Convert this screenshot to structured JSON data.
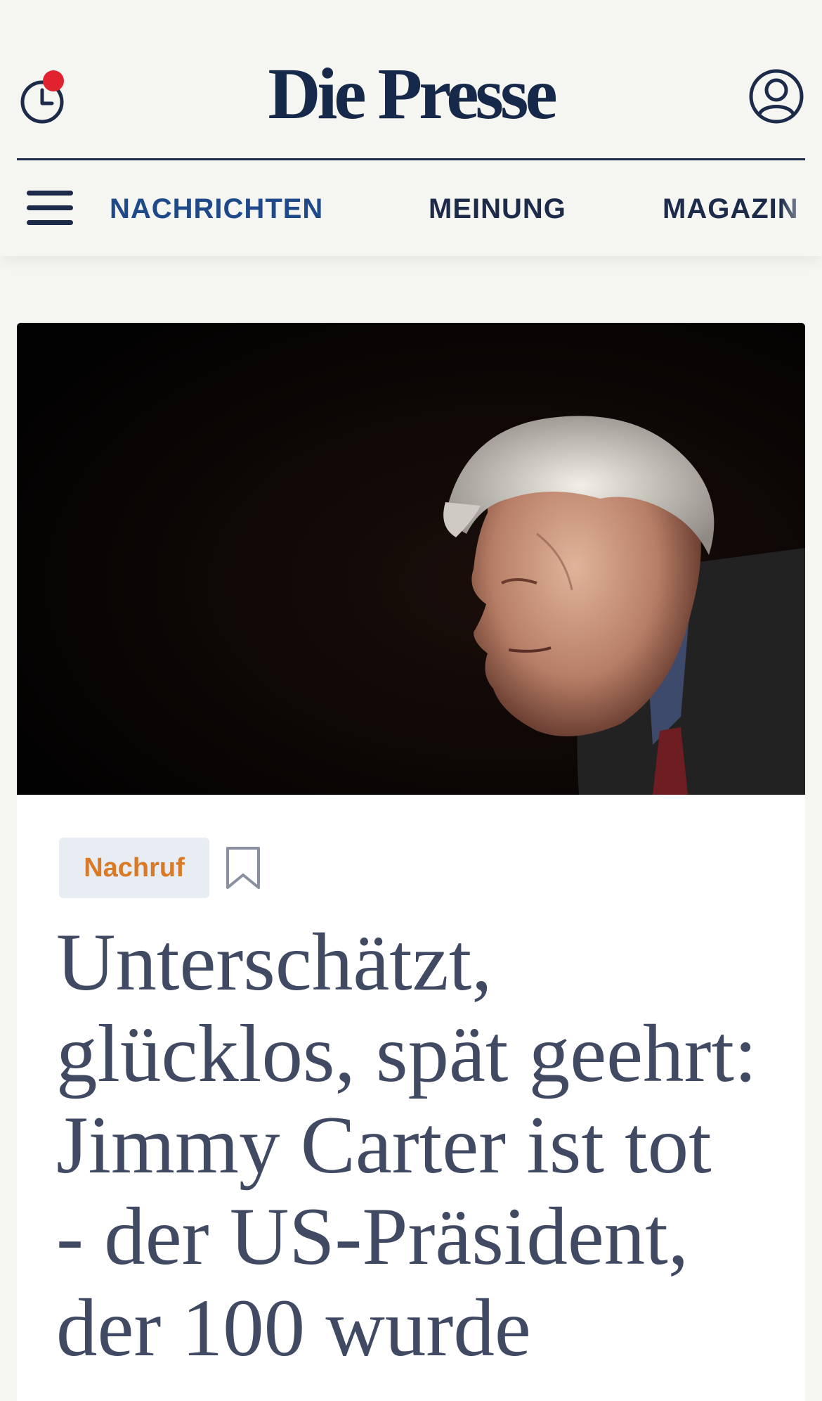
{
  "header": {
    "logo_text": "Die Presse",
    "history_icon": "clock-icon",
    "account_icon": "user-circle-icon",
    "notification_color": "#e0232e",
    "brand_color": "#1c2b4a"
  },
  "nav": {
    "menu_icon": "hamburger-menu-icon",
    "items": [
      {
        "label": "NACHRICHTEN",
        "active": true
      },
      {
        "label": "MEINUNG",
        "active": false
      },
      {
        "label": "MAGAZIN",
        "active": false
      }
    ]
  },
  "article": {
    "image_alt": "Portrait of Jimmy Carter against a dark background",
    "tag": "Nachruf",
    "tag_color": "#d87a27",
    "bookmark_icon": "bookmark-icon",
    "headline_lines": [
      "Unterschätzt,",
      "glücklos, spät geehrt:",
      "Jimmy Carter ist tot",
      "- der US-Präsident,",
      "der 100 wurde"
    ]
  }
}
